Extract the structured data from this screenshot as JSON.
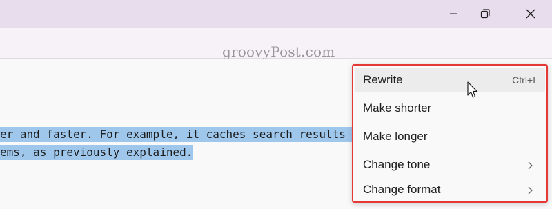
{
  "window": {
    "minimize_icon": "minimize-icon",
    "restore_icon": "restore-icon",
    "close_icon": "close-icon"
  },
  "watermark": "groovyPost.com",
  "toolbar": {
    "copilot_icon": "copilot-sparkle-pen-icon",
    "dropdown_icon": "chevron-down-icon",
    "avatar_icon": "user-avatar",
    "settings_icon": "gear-icon",
    "accent_arrow_color": "#e53935"
  },
  "editor": {
    "selected_lines": [
      "er and faster. For example, it caches search results",
      "ems, as previously explained."
    ],
    "selection_color": "#9fc7ec"
  },
  "menu": {
    "items": [
      {
        "label": "Rewrite",
        "shortcut": "Ctrl+I"
      },
      {
        "label": "Make shorter"
      },
      {
        "label": "Make longer"
      },
      {
        "label": "Change tone",
        "submenu_icon": "chevron-right-icon"
      },
      {
        "label": "Change format",
        "submenu_icon": "chevron-right-icon"
      }
    ],
    "highlight_color": "#e53935"
  }
}
